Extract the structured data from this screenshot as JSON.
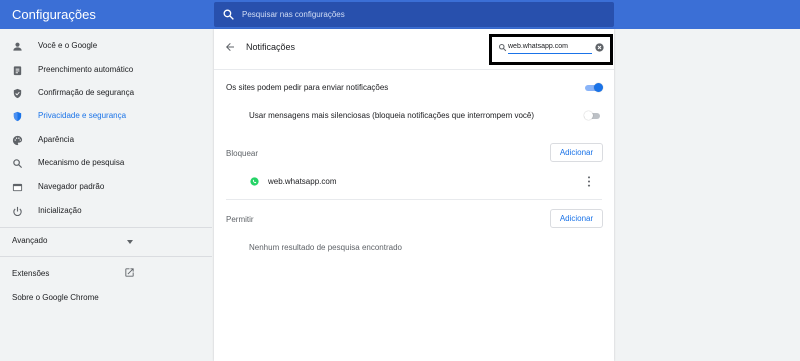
{
  "header": {
    "title": "Configurações",
    "search_placeholder": "Pesquisar nas configurações",
    "color": "#3b6fd6"
  },
  "sidebar": {
    "items": [
      {
        "label": "Você e o Google",
        "icon": "person-icon"
      },
      {
        "label": "Preenchimento automático",
        "icon": "clipboard-icon"
      },
      {
        "label": "Confirmação de segurança",
        "icon": "shield-check-icon"
      },
      {
        "label": "Privacidade e segurança",
        "icon": "shield-icon",
        "active": true
      },
      {
        "label": "Aparência",
        "icon": "palette-icon"
      },
      {
        "label": "Mecanismo de pesquisa",
        "icon": "search-icon"
      },
      {
        "label": "Navegador padrão",
        "icon": "browser-window-icon"
      },
      {
        "label": "Inicialização",
        "icon": "power-icon"
      }
    ],
    "advanced": "Avançado",
    "extensions": "Extensões",
    "about": "Sobre o Google Chrome"
  },
  "notifications": {
    "title": "Notificações",
    "filter_value": "web.whatsapp.com",
    "allow_request_label": "Os sites podem pedir para enviar notificações",
    "allow_request_on": true,
    "quieter_label": "Usar mensagens mais silenciosas (bloqueia notificações que interrompem você)",
    "quieter_on": false,
    "block": {
      "label": "Bloquear",
      "add_button": "Adicionar",
      "sites": [
        "web.whatsapp.com"
      ]
    },
    "allow": {
      "label": "Permitir",
      "add_button": "Adicionar",
      "empty_text": "Nenhum resultado de pesquisa encontrado"
    }
  },
  "colors": {
    "accent": "#1a73e8",
    "whatsapp": "#25d366"
  }
}
